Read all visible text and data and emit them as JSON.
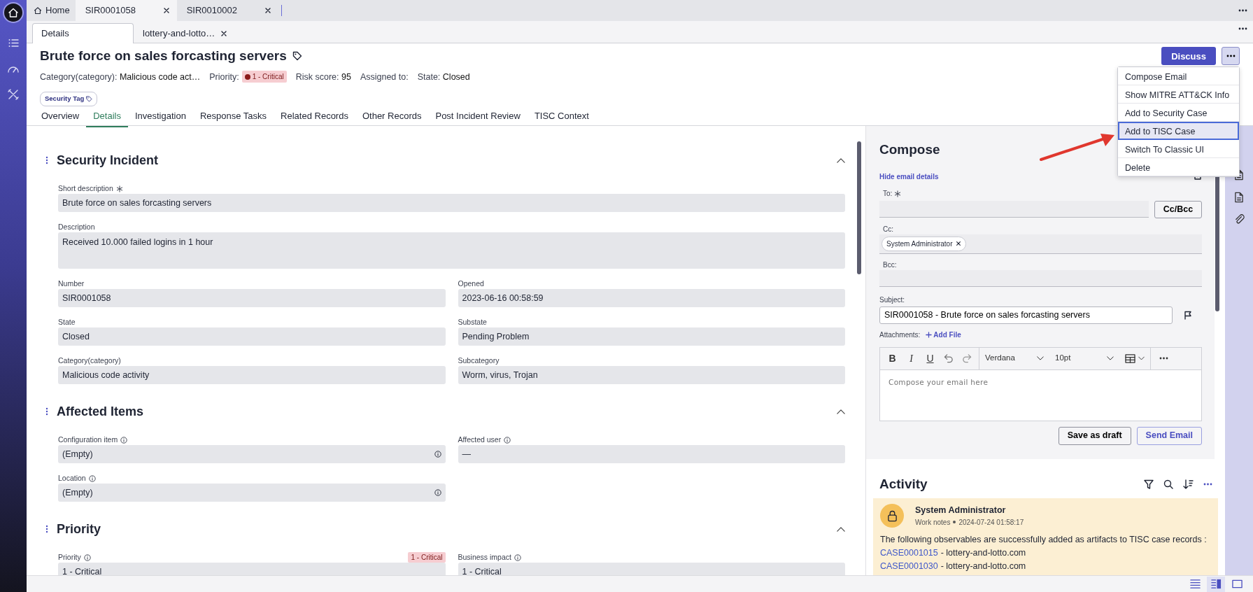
{
  "app_tabs": [
    {
      "label": "Home",
      "kind": "home",
      "selected": false
    },
    {
      "label": "SIR0001058",
      "kind": "record",
      "selected": true
    },
    {
      "label": "SIR0010002",
      "kind": "record",
      "selected": false
    }
  ],
  "sub_tabs": [
    {
      "label": "Details",
      "kind": "plain",
      "selected": true
    },
    {
      "label": "lottery-and-lotto…",
      "kind": "closable",
      "selected": false
    }
  ],
  "record": {
    "title": "Brute force on sales forcasting servers",
    "discuss": "Discuss",
    "tags": [
      "Security Tag"
    ],
    "meta": [
      {
        "kind": "text",
        "label": "Category(category):",
        "value": "Malicious code act…"
      },
      {
        "kind": "badge",
        "label": "Priority:",
        "value": "1 - Critical"
      },
      {
        "kind": "text",
        "label": "Risk score:",
        "value": "95"
      },
      {
        "kind": "empty",
        "label": "Assigned to:"
      },
      {
        "kind": "text",
        "label": "State:",
        "value": "Closed"
      }
    ]
  },
  "record_tabs": [
    {
      "label": "Overview",
      "selected": false
    },
    {
      "label": "Details",
      "selected": true
    },
    {
      "label": "Investigation",
      "selected": false
    },
    {
      "label": "Response Tasks",
      "selected": false
    },
    {
      "label": "Related Records",
      "selected": false
    },
    {
      "label": "Other Records",
      "selected": false
    },
    {
      "label": "Post Incident Review",
      "selected": false
    },
    {
      "label": "TISC Context",
      "selected": false
    }
  ],
  "more_menu": {
    "expanded": true,
    "items": [
      {
        "label": "Compose Email",
        "selected": false
      },
      {
        "label": "Show MITRE ATT&CK Info",
        "selected": false
      },
      {
        "label": "Add to Security Case",
        "selected": false
      },
      {
        "label": "Add to TISC Case",
        "selected": true
      },
      {
        "label": "Switch To Classic UI",
        "selected": false
      },
      {
        "label": "Delete",
        "selected": false
      }
    ]
  },
  "sections": [
    {
      "title": "Security Incident",
      "expanded": true,
      "wide_fields": [
        {
          "label": "Short description",
          "required": true,
          "kind": "text",
          "value": "Brute force on sales forcasting servers"
        },
        {
          "label": "Description",
          "kind": "textarea",
          "value": "Received 10.000 failed logins in 1 hour"
        }
      ],
      "rows": [
        [
          {
            "label": "Number",
            "kind": "text",
            "value": "SIR0001058"
          },
          {
            "label": "Opened",
            "kind": "text",
            "value": "2023-06-16 00:58:59"
          }
        ],
        [
          {
            "label": "State",
            "kind": "text",
            "value": "Closed"
          },
          {
            "label": "Substate",
            "kind": "text",
            "value": "Pending Problem"
          }
        ],
        [
          {
            "label": "Category(category)",
            "kind": "text",
            "value": "Malicious code activity"
          },
          {
            "label": "Subcategory",
            "kind": "text",
            "value": "Worm, virus, Trojan"
          }
        ]
      ]
    },
    {
      "title": "Affected Items",
      "expanded": true,
      "rows": [
        [
          {
            "label": "Configuration item",
            "info": true,
            "kind": "reference",
            "value": "(Empty)"
          },
          {
            "label": "Affected user",
            "info": true,
            "kind": "text",
            "value": "—"
          }
        ],
        [
          {
            "label": "Location",
            "info": true,
            "kind": "reference",
            "value": "(Empty)"
          }
        ]
      ]
    },
    {
      "title": "Priority",
      "expanded": true,
      "rows": [
        [
          {
            "label": "Priority",
            "info": true,
            "badge": "1 - Critical",
            "kind": "text",
            "value": "1 - Critical"
          },
          {
            "label": "Business impact",
            "info": true,
            "kind": "text",
            "value": "1 - Critical"
          }
        ]
      ]
    }
  ],
  "compose": {
    "title": "Compose",
    "details_link": "Hide email details",
    "to": {
      "label": "To:",
      "required": true
    },
    "cc_bcc_button": "Cc/Bcc",
    "cc": {
      "label": "Cc:",
      "chips": [
        "System Administrator"
      ]
    },
    "bcc": {
      "label": "Bcc:"
    },
    "subject": {
      "label": "Subject:",
      "value": "SIR0001058 - Brute force on sales forcasting servers"
    },
    "attachments": {
      "label": "Attachments:",
      "add": "Add File"
    },
    "format_buttons": [
      {
        "label": "B",
        "kind": "bold"
      },
      {
        "label": "I",
        "kind": "italic"
      },
      {
        "label": "U",
        "kind": "underline"
      }
    ],
    "font": "Verdana",
    "size": "10pt",
    "placeholder": "Compose your email here",
    "save_button": "Save as draft",
    "send_button": "Send Email"
  },
  "activity": {
    "title": "Activity",
    "entries": [
      {
        "author": "System Administrator",
        "type": "Work notes",
        "time": "2024-07-24 01:58:17",
        "text": "The following observables are successfully added as artifacts to TISC case records :",
        "links": [
          {
            "case": "CASE0001015",
            "target": "- lottery-and-lotto.com"
          },
          {
            "case": "CASE0001030",
            "target": "- lottery-and-lotto.com"
          }
        ]
      }
    ]
  },
  "view_modes": [
    {
      "kind": "list",
      "selected": false
    },
    {
      "kind": "split",
      "selected": true
    },
    {
      "kind": "single",
      "selected": false
    }
  ]
}
